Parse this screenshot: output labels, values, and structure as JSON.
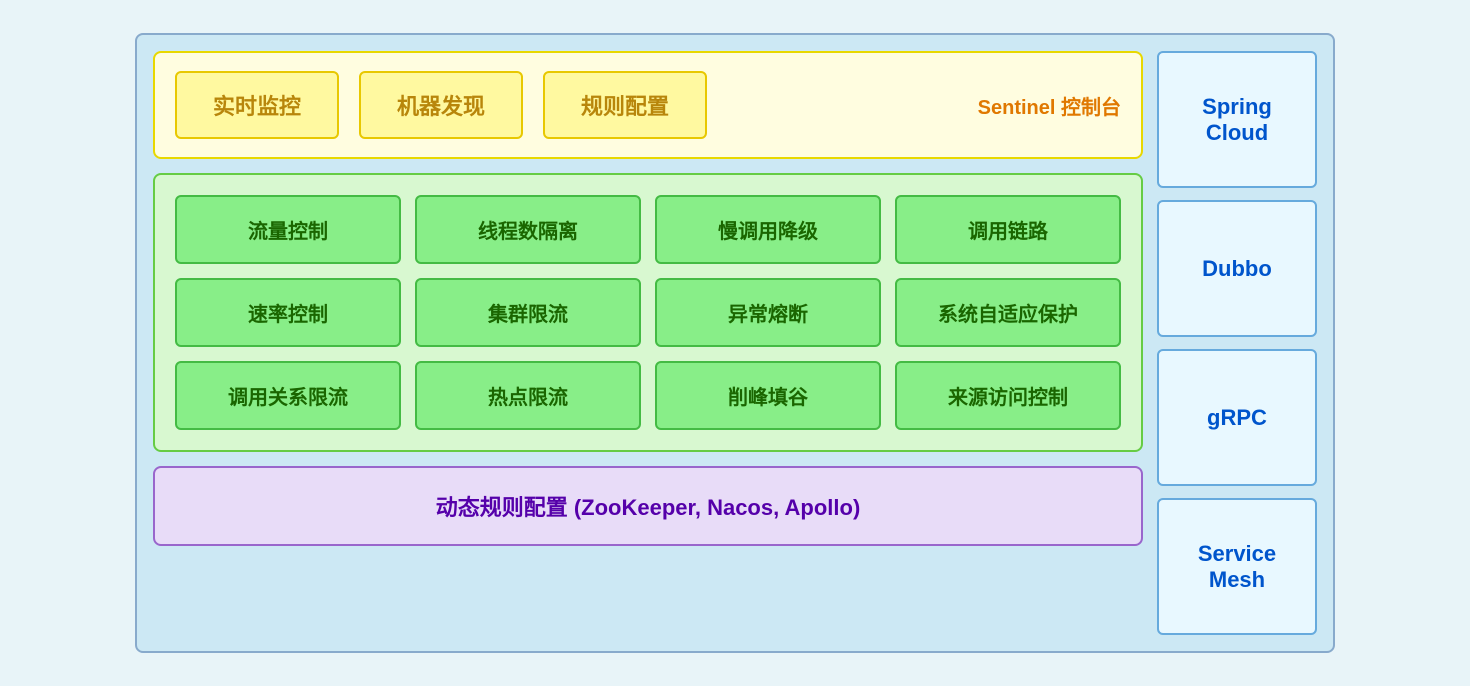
{
  "sentinel": {
    "panel_label": "Sentinel 控制台",
    "boxes": [
      "实时监控",
      "机器发现",
      "规则配置"
    ]
  },
  "features": {
    "rows": [
      [
        "流量控制",
        "线程数隔离",
        "慢调用降级",
        "调用链路"
      ],
      [
        "速率控制",
        "集群限流",
        "异常熔断",
        "系统自适应保护"
      ],
      [
        "调用关系限流",
        "热点限流",
        "削峰填谷",
        "来源访问控制"
      ]
    ]
  },
  "dynamic": {
    "label": "动态规则配置 (ZooKeeper, Nacos, Apollo)"
  },
  "sidebar": {
    "items": [
      "Spring Cloud",
      "Dubbo",
      "gRPC",
      "Service Mesh"
    ]
  }
}
